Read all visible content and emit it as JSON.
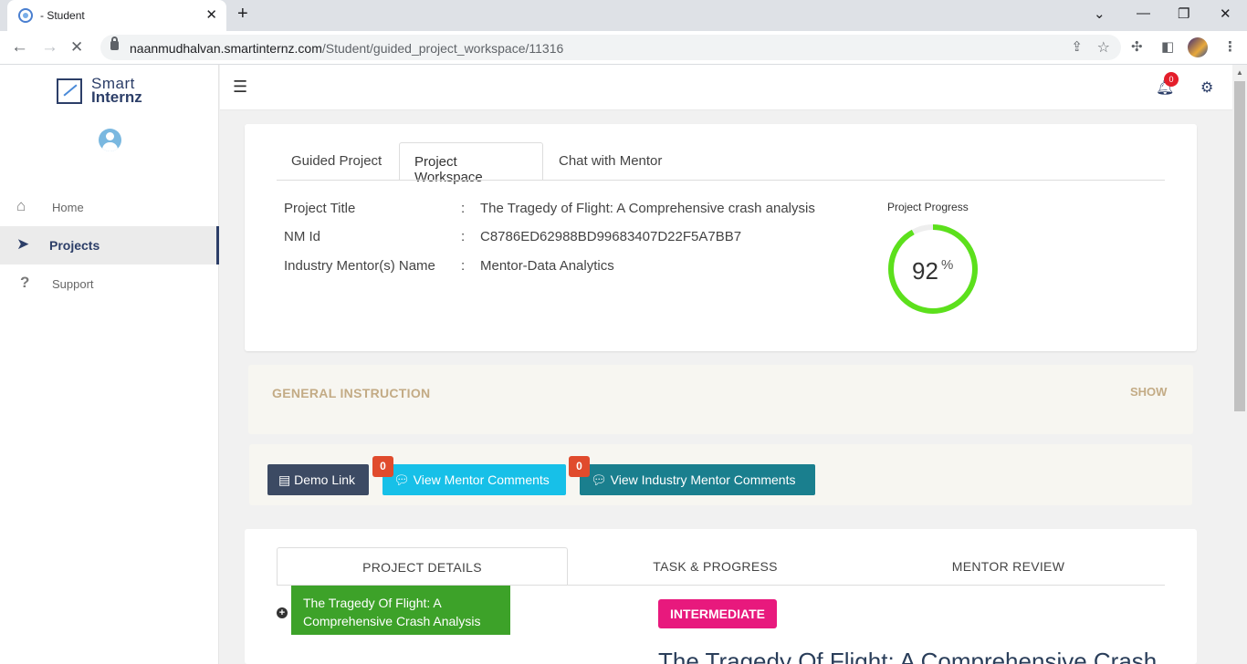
{
  "browser": {
    "tab_title": "- Student",
    "url_host": "naanmudhalvan.smartinternz.com",
    "url_path": "/Student/guided_project_workspace/11316"
  },
  "brand": {
    "line1": "Smart",
    "line2": "Internz"
  },
  "sidebar": {
    "items": [
      {
        "label": "Home",
        "icon": "home-icon"
      },
      {
        "label": "Projects",
        "icon": "paper-plane-icon",
        "active": true
      },
      {
        "label": "Support",
        "icon": "question-icon"
      }
    ]
  },
  "topbar": {
    "notification_count": "0"
  },
  "workspace": {
    "tabs": [
      {
        "label": "Guided Project"
      },
      {
        "label": "Project Workspace",
        "active": true
      },
      {
        "label": "Chat with Mentor"
      }
    ],
    "info": [
      {
        "label": "Project Title",
        "colon": ":",
        "value": "The Tragedy of Flight: A Comprehensive crash analysis"
      },
      {
        "label": "NM Id",
        "colon": ":",
        "value": "C8786ED62988BD99683407D22F5A7BB7"
      },
      {
        "label": "Industry Mentor(s) Name",
        "colon": ":",
        "value": "Mentor-Data Analytics"
      }
    ],
    "progress": {
      "label": "Project Progress",
      "value": "92",
      "percent_sign": "%",
      "fraction": 0.92,
      "color": "#5ce01c"
    }
  },
  "general": {
    "title": "GENERAL INSTRUCTION",
    "toggle": "SHOW"
  },
  "actions": {
    "demo": "Demo Link",
    "mentor": "View Mentor Comments",
    "mentor_count": "0",
    "industry": "View Industry Mentor Comments",
    "industry_count": "0"
  },
  "details": {
    "tabs": [
      {
        "label": "PROJECT DETAILS",
        "active": true
      },
      {
        "label": "TASK & PROGRESS"
      },
      {
        "label": "MENTOR REVIEW"
      }
    ],
    "project_name": "The Tragedy Of Flight: A Comprehensive Crash Analysis",
    "level": "INTERMEDIATE",
    "heading": "The Tragedy Of Flight: A Comprehensive Crash"
  }
}
